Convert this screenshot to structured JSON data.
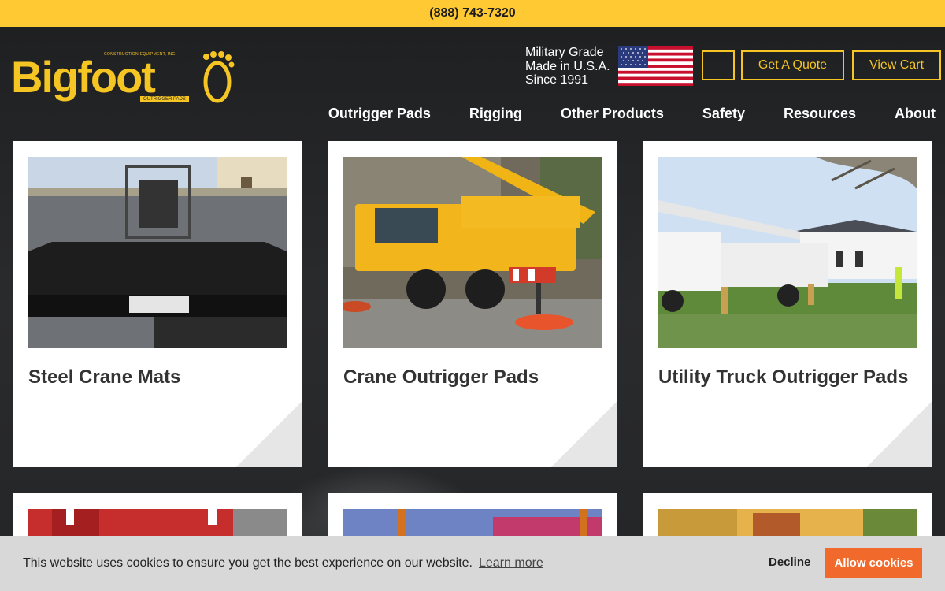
{
  "topbar": {
    "phone": "(888) 743-7320"
  },
  "header": {
    "logo": {
      "name": "Bigfoot",
      "small_text": "CONSTRUCTION EQUIPMENT, INC.",
      "tag_text": "OUTRIGGER PADS"
    },
    "tagline_lines": [
      "Military Grade",
      "Made in U.S.A.",
      "Since 1991"
    ],
    "flag_icon": "us-flag-icon",
    "search_icon": "search-icon",
    "quote_label": "Get A Quote",
    "cart_label": "View Cart"
  },
  "nav": [
    "Outrigger Pads",
    "Rigging",
    "Other Products",
    "Safety",
    "Resources",
    "About"
  ],
  "cards": [
    {
      "title": "Steel Crane Mats"
    },
    {
      "title": "Crane Outrigger Pads"
    },
    {
      "title": "Utility Truck Outrigger Pads"
    }
  ],
  "cookie": {
    "message": "This website uses cookies to ensure you get the best experience on our website.",
    "learn_more": "Learn more",
    "decline": "Decline",
    "allow": "Allow cookies"
  },
  "colors": {
    "accent": "#ffc934",
    "logo": "#f5c524",
    "allow_button": "#f26a2b",
    "background": "#222325"
  }
}
